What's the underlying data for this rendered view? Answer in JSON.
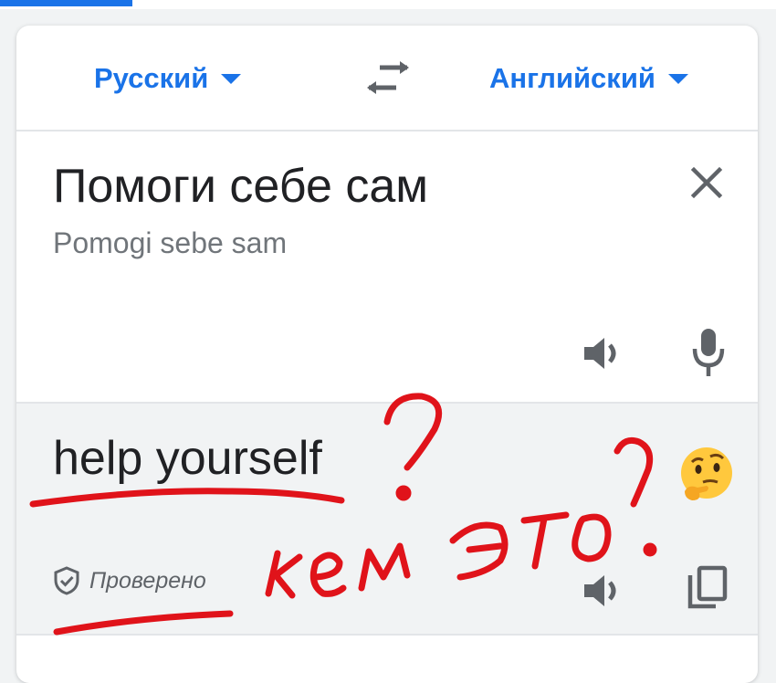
{
  "header": {
    "active_tab_indicator_color": "#1a73e8"
  },
  "language_bar": {
    "source_language": "Русский",
    "target_language": "Английский",
    "swap_icon": "swap-arrows-icon",
    "accent_color": "#1a73e8"
  },
  "source": {
    "text": "Помоги себе сам",
    "transliteration": "Pomogi sebe sam",
    "icons": [
      "close-icon",
      "speaker-icon",
      "microphone-icon"
    ]
  },
  "result": {
    "text": "help yourself",
    "verified_label": "Проверено",
    "icons": [
      "thinking-face-emoji",
      "verified-shield-icon",
      "speaker-icon",
      "copy-icon"
    ]
  },
  "annotation": {
    "handwritten_text": "кем это?",
    "question_mark": "?",
    "ink_color": "#e0131a"
  }
}
